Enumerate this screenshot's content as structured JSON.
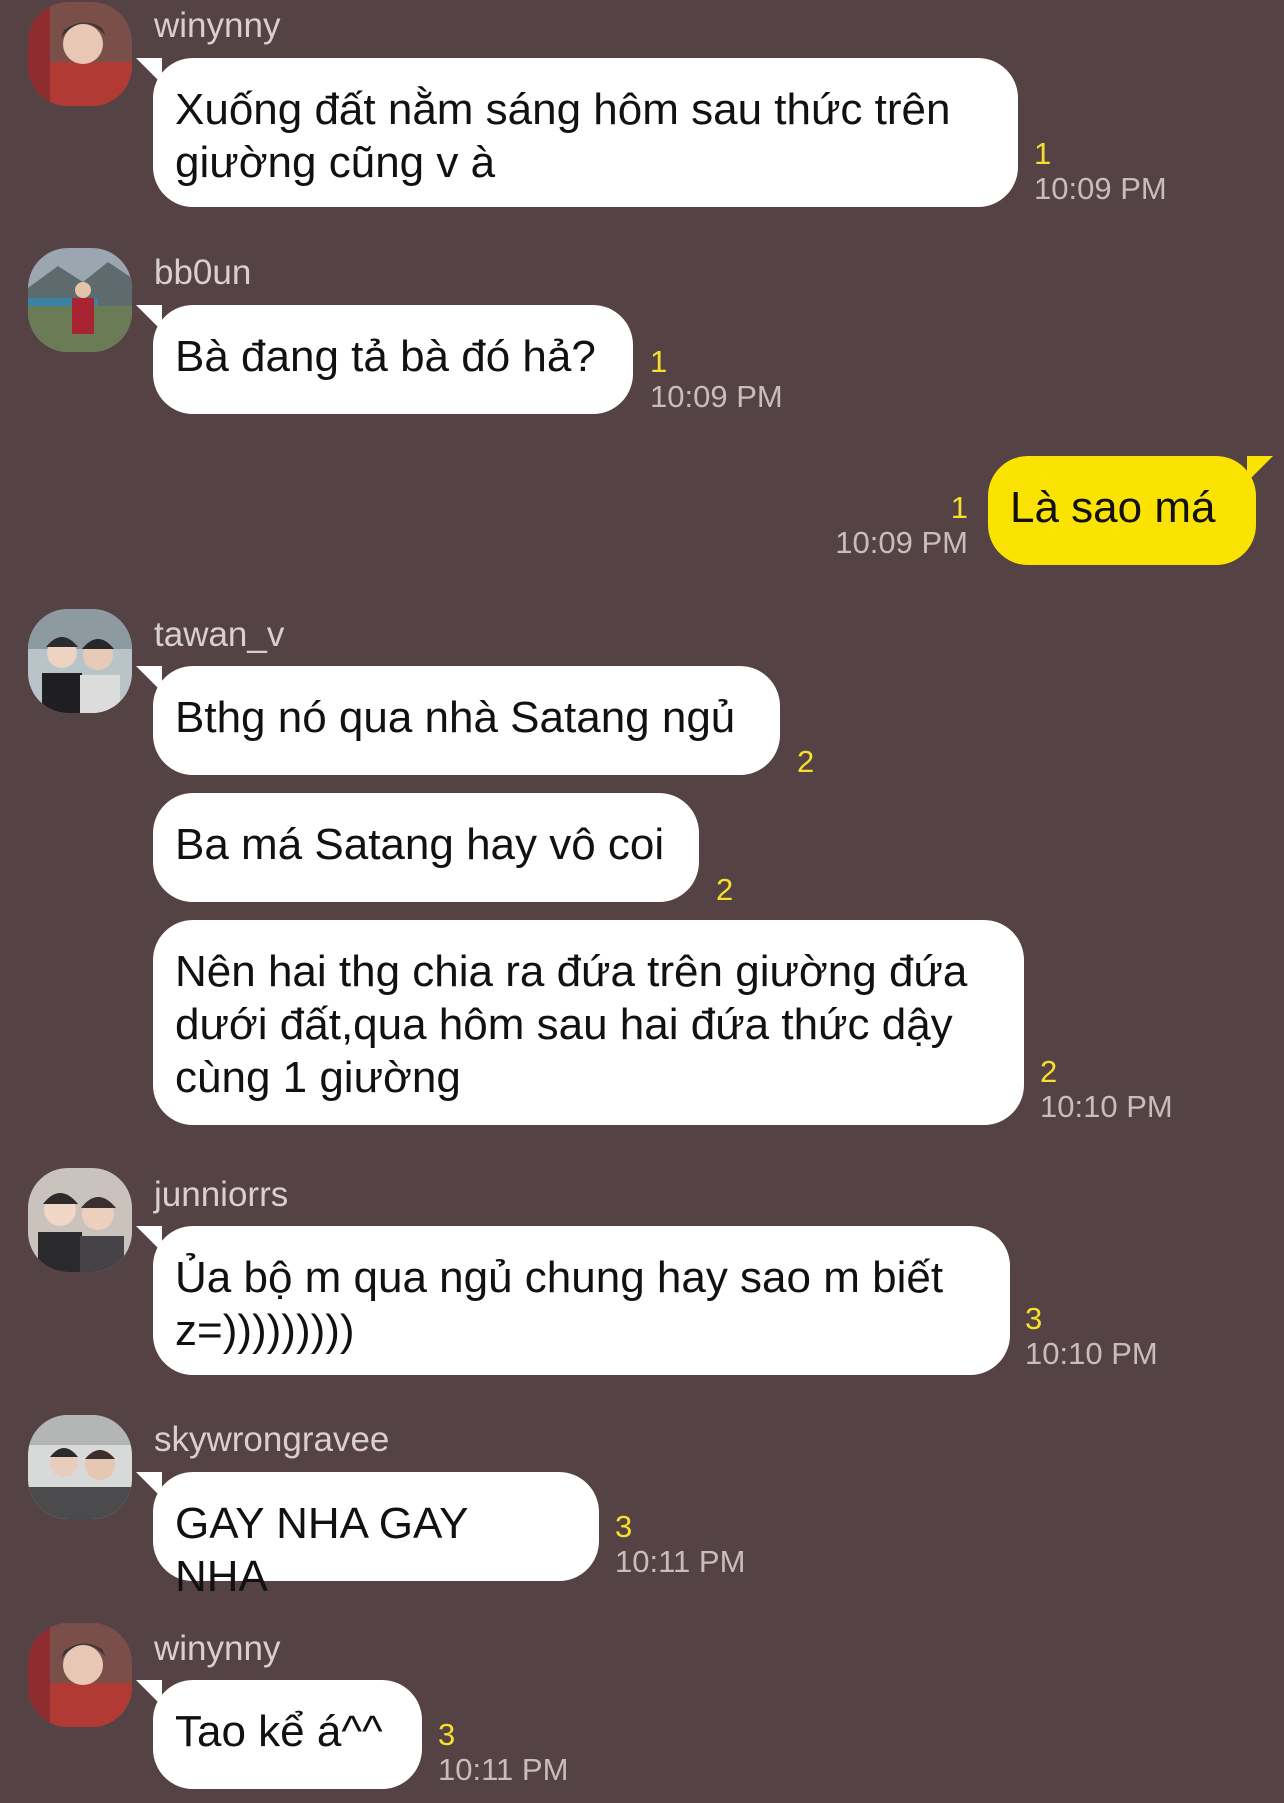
{
  "messages": [
    {
      "sender": "winynny",
      "text_lines": [
        "Xuống đất nằm sáng hôm sau thức trên",
        "giường cũng v à"
      ],
      "read_count": "1",
      "time": "10:09 PM"
    },
    {
      "sender": "bb0un",
      "text_lines": [
        "Bà đang tả bà đó hả?"
      ],
      "read_count": "1",
      "time": "10:09 PM"
    },
    {
      "sender": "me",
      "text_lines": [
        "Là sao má"
      ],
      "read_count": "1",
      "time": "10:09 PM"
    },
    {
      "sender": "tawan_v",
      "text_lines": [
        "Bthg nó qua nhà Satang ngủ"
      ],
      "read_count": "2",
      "time": ""
    },
    {
      "sender": "tawan_v",
      "text_lines": [
        "Ba má Satang hay vô coi"
      ],
      "read_count": "2",
      "time": ""
    },
    {
      "sender": "tawan_v",
      "text_lines": [
        "Nên hai thg chia ra đứa trên giường đứa",
        "dưới đất,qua hôm sau hai đứa thức dậy",
        "cùng 1 giường"
      ],
      "read_count": "2",
      "time": "10:10 PM"
    },
    {
      "sender": "junniorrs",
      "text_lines": [
        "Ủa bộ m qua ngủ chung hay sao m biết",
        "z=)))))))))"
      ],
      "read_count": "3",
      "time": "10:10 PM"
    },
    {
      "sender": "skywrongravee",
      "text_lines": [
        "GAY NHA GAY NHA"
      ],
      "read_count": "3",
      "time": "10:11 PM"
    },
    {
      "sender": "winynny",
      "text_lines": [
        "Tao kể á^^"
      ],
      "read_count": "3",
      "time": "10:11 PM"
    }
  ],
  "icons": {
    "avatar": "profile-photo"
  },
  "colors": {
    "background": "#554244",
    "incoming_bubble": "#ffffff",
    "outgoing_bubble": "#fbe300",
    "read_count": "#f7df2c"
  }
}
